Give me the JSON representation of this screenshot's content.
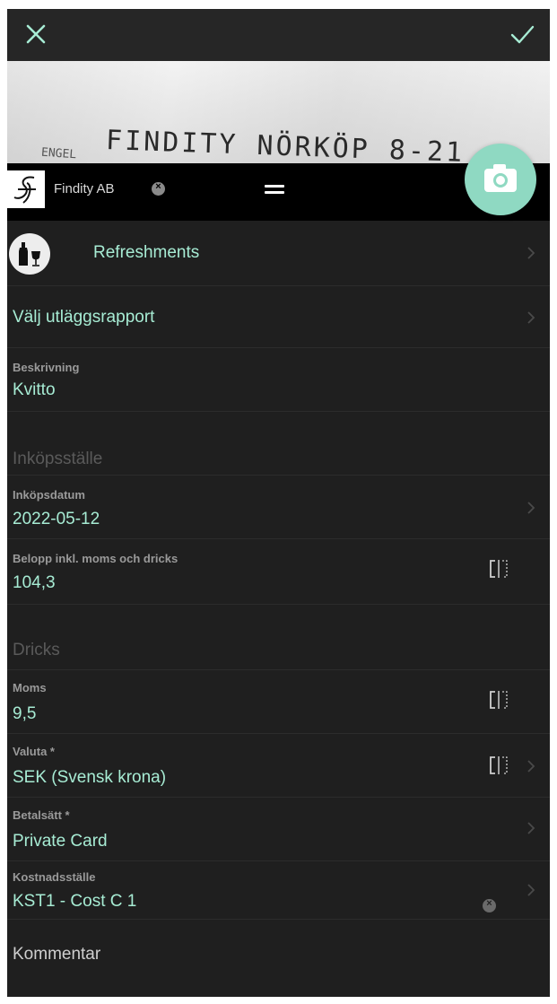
{
  "company": {
    "name": "Findity AB",
    "clear_icon": "close-circle-icon",
    "logo_text": "ℱ"
  },
  "receipt_image": {
    "line1": "FINDITY NÖRKÖP 8-21",
    "line2": "ENGEL"
  },
  "category": {
    "label": "Refreshments",
    "icon": "wine-bottle-glass-icon"
  },
  "report": {
    "label": "Välj utläggsrapport"
  },
  "fields": {
    "description": {
      "label": "Beskrivning",
      "value": "Kvitto"
    },
    "merchant": {
      "placeholder": "Inköpsställe"
    },
    "date": {
      "label": "Inköpsdatum",
      "value": "2022-05-12"
    },
    "amount": {
      "label": "Belopp inkl. moms och dricks",
      "value": "104,3"
    },
    "tip": {
      "placeholder": "Dricks"
    },
    "vat": {
      "label": "Moms",
      "value": "9,5"
    },
    "currency": {
      "label": "Valuta *",
      "value": "SEK (Svensk krona)"
    },
    "payment": {
      "label": "Betalsätt *",
      "value": "Private Card"
    },
    "cost_center": {
      "label": "Kostnadsställe",
      "value": "KST1 - Cost C 1"
    },
    "comment": {
      "placeholder": "Kommentar"
    }
  },
  "colors": {
    "accent": "#a7ecd4",
    "camera_button": "#8fd9c2",
    "background": "#1f1f1f"
  }
}
